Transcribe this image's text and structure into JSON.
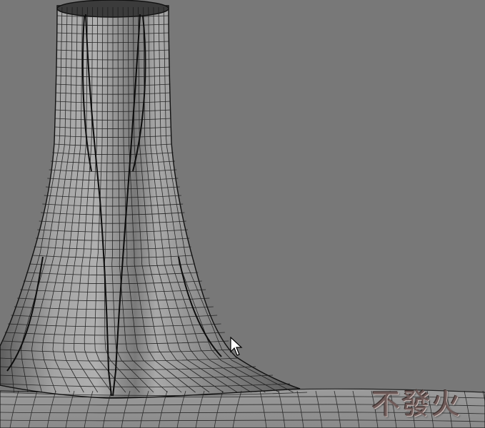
{
  "viewport": {
    "background": "#787878",
    "mesh_fill": "#9a9a9a",
    "mesh_shadow": "#6a6a6a",
    "wire_color": "#1a1a1a"
  },
  "objects": [
    {
      "name": "tree-trunk-mesh",
      "kind": "polygon-mesh",
      "display": "shaded-wireframe"
    },
    {
      "name": "ground-plane-mesh",
      "kind": "polygon-mesh",
      "display": "shaded-wireframe"
    }
  ],
  "cursor": {
    "icon": "arrow-cursor-icon"
  },
  "watermark": {
    "text": "不發火",
    "color": "#6e5a58"
  }
}
